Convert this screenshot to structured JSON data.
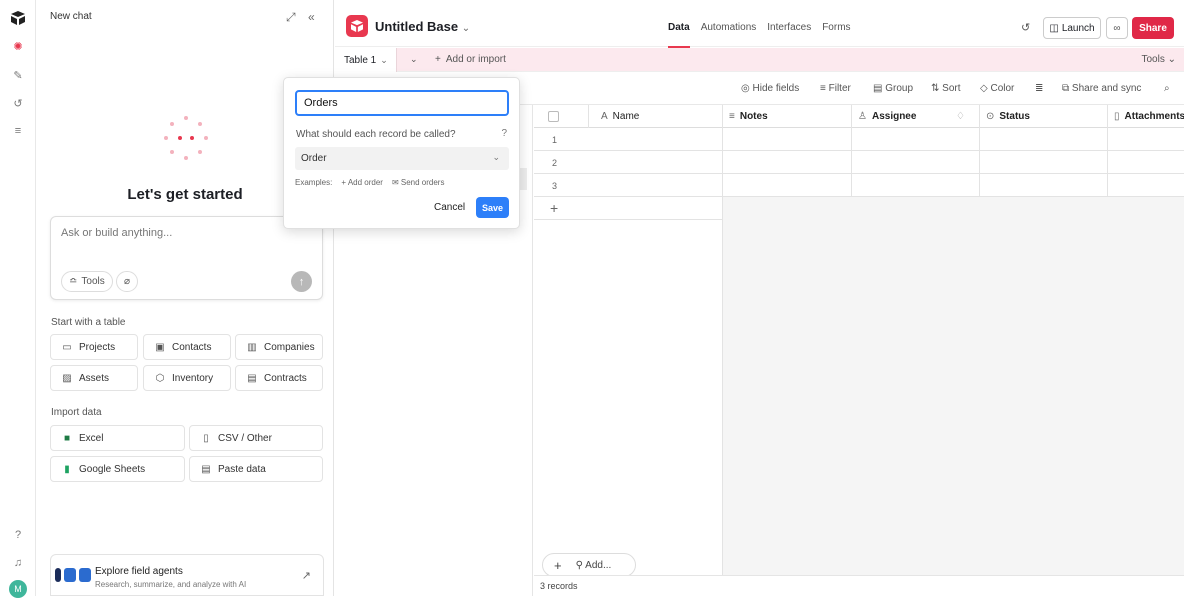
{
  "chat": {
    "title": "New chat",
    "heading": "Let's get started",
    "input_placeholder": "Ask or build anything...",
    "tools_label": "Tools",
    "start_section": "Start with a table",
    "templates": [
      "Projects",
      "Contacts",
      "Companies",
      "Assets",
      "Inventory",
      "Contracts"
    ],
    "import_section": "Import data",
    "imports": [
      "Excel",
      "CSV / Other",
      "Google Sheets",
      "Paste data"
    ],
    "agents_title": "Explore field agents",
    "agents_subtitle": "Research, summarize, and analyze with AI"
  },
  "app": {
    "base_name": "Untitled Base",
    "nav": [
      "Data",
      "Automations",
      "Interfaces",
      "Forms"
    ],
    "active_nav": "Data",
    "launch_label": "Launch",
    "share_label": "Share",
    "accent_color": "#e02847",
    "primary_color": "#2d7ff9"
  },
  "tablebar": {
    "table_name": "Table 1",
    "add_import": "Add or import",
    "tools": "Tools"
  },
  "viewbar": {
    "hide_fields": "Hide fields",
    "filter": "Filter",
    "group": "Group",
    "sort": "Sort",
    "color": "Color",
    "share_sync": "Share and sync"
  },
  "grid": {
    "columns": [
      "Name",
      "Notes",
      "Assignee",
      "Status",
      "Attachments"
    ],
    "rows": [
      "1",
      "2",
      "3"
    ],
    "add_label": "Add...",
    "record_count": "3 records"
  },
  "popup": {
    "input_value": "Orders",
    "question": "What should each record be called?",
    "selected": "Order",
    "examples_label": "Examples:",
    "example_add": "Add order",
    "example_send": "Send orders",
    "cancel": "Cancel",
    "save": "Save"
  }
}
